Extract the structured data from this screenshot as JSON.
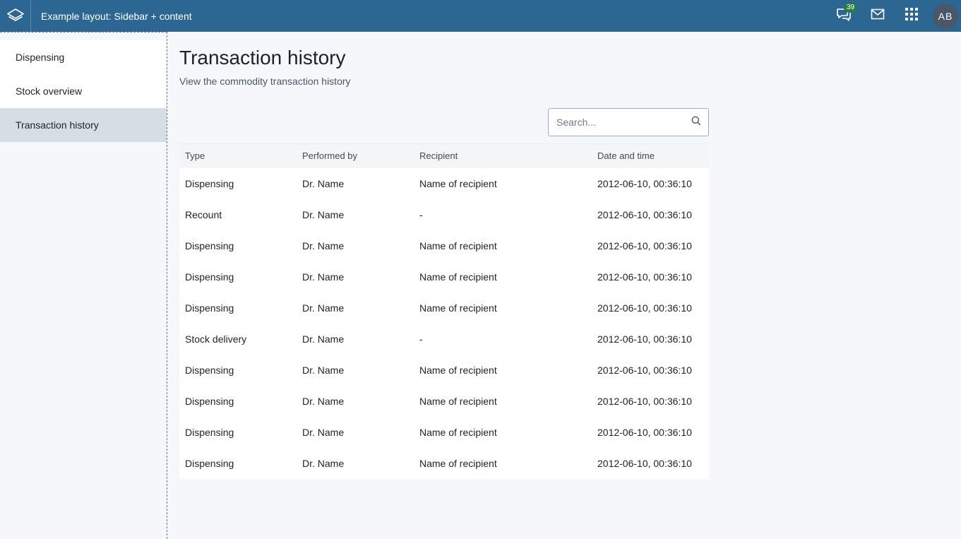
{
  "header": {
    "title": "Example layout: Sidebar + content",
    "notification_count": "39",
    "avatar_initials": "AB",
    "icons": [
      "apps-logo-icon",
      "chat-icon",
      "mail-icon",
      "grid-icon"
    ]
  },
  "sidebar": {
    "items": [
      {
        "label": "Dispensing",
        "active": false
      },
      {
        "label": "Stock overview",
        "active": false
      },
      {
        "label": "Transaction history",
        "active": true
      }
    ]
  },
  "main": {
    "title": "Transaction history",
    "subtitle": "View the commodity transaction history",
    "search": {
      "placeholder": "Search..."
    },
    "table": {
      "columns": [
        "Type",
        "Performed by",
        "Recipient",
        "Date and time"
      ],
      "rows": [
        [
          "Dispensing",
          "Dr. Name",
          "Name of recipient",
          "2012-06-10, 00:36:10"
        ],
        [
          "Recount",
          "Dr. Name",
          "-",
          "2012-06-10, 00:36:10"
        ],
        [
          "Dispensing",
          "Dr. Name",
          "Name of recipient",
          "2012-06-10, 00:36:10"
        ],
        [
          "Dispensing",
          "Dr. Name",
          "Name of recipient",
          "2012-06-10, 00:36:10"
        ],
        [
          "Dispensing",
          "Dr. Name",
          "Name of recipient",
          "2012-06-10, 00:36:10"
        ],
        [
          "Stock delivery",
          "Dr. Name",
          "-",
          "2012-06-10, 00:36:10"
        ],
        [
          "Dispensing",
          "Dr. Name",
          "Name of recipient",
          "2012-06-10, 00:36:10"
        ],
        [
          "Dispensing",
          "Dr. Name",
          "Name of recipient",
          "2012-06-10, 00:36:10"
        ],
        [
          "Dispensing",
          "Dr. Name",
          "Name of recipient",
          "2012-06-10, 00:36:10"
        ],
        [
          "Dispensing",
          "Dr. Name",
          "Name of recipient",
          "2012-06-10, 00:36:10"
        ]
      ]
    }
  },
  "colors": {
    "header_bg": "#2c6693",
    "active_nav_bg": "#d5dde5",
    "badge_bg": "#2a7a4a"
  }
}
